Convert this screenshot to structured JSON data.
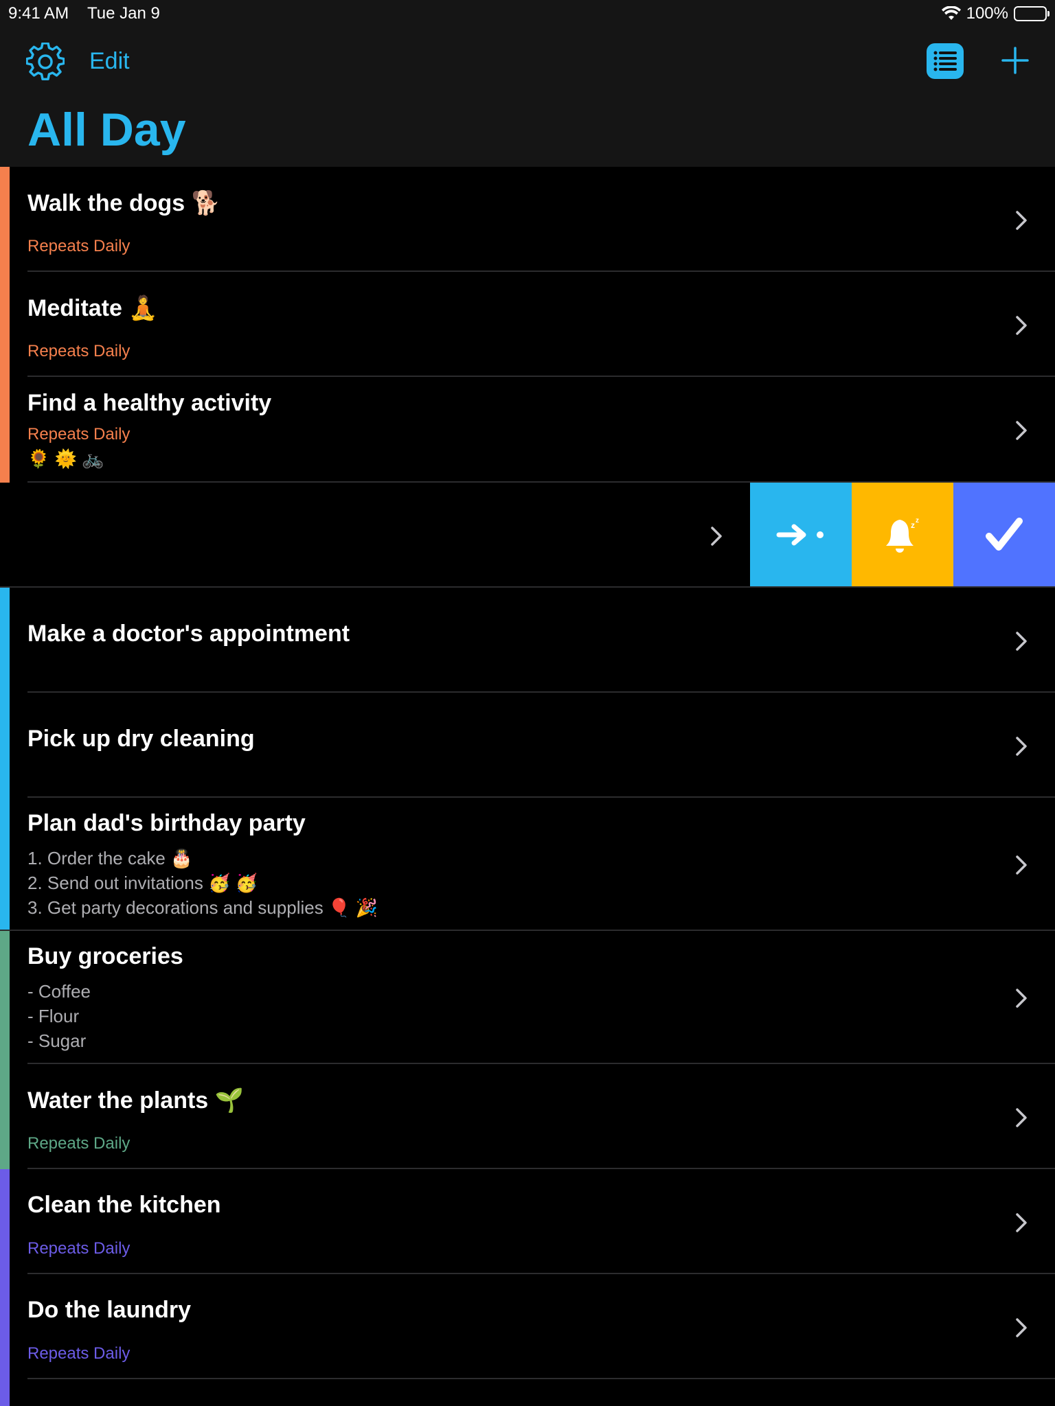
{
  "status": {
    "time": "9:41 AM",
    "date": "Tue Jan 9",
    "battery": "100%"
  },
  "header": {
    "edit_label": "Edit",
    "title": "All Day"
  },
  "colors": {
    "accent": "#29b6ee",
    "orange": "#f5804d",
    "blue": "#29b6ee",
    "green": "#5ea887",
    "purple": "#6c5ce7",
    "snooze": "#ffb800",
    "complete": "#5073ff"
  },
  "items": [
    {
      "title": "Walk the dogs 🐕",
      "subtitle": "Repeats Daily"
    },
    {
      "title": "Meditate 🧘",
      "subtitle": "Repeats Daily"
    },
    {
      "title": "Find a healthy activity",
      "subtitle": "Repeats Daily",
      "emoji": "🌻 🌞 🚲"
    },
    {
      "title": "Make a doctor's appointment"
    },
    {
      "title": "Pick up dry cleaning"
    },
    {
      "title": "Plan dad's birthday party",
      "notes": [
        "1. Order the cake 🎂",
        "2. Send out invitations 🥳 🥳",
        "3. Get party decorations and supplies 🎈 🎉"
      ]
    },
    {
      "title": "Buy groceries",
      "notes": [
        "- Coffee",
        "- Flour",
        "- Sugar"
      ]
    },
    {
      "title": "Water the plants 🌱",
      "subtitle": "Repeats Daily"
    },
    {
      "title": "Clean the kitchen",
      "subtitle": "Repeats Daily"
    },
    {
      "title": "Do the laundry",
      "subtitle": "Repeats Daily"
    }
  ],
  "swipe_actions": [
    {
      "icon": "move-to-icon"
    },
    {
      "icon": "snooze-bell-icon"
    },
    {
      "icon": "checkmark-icon"
    }
  ]
}
